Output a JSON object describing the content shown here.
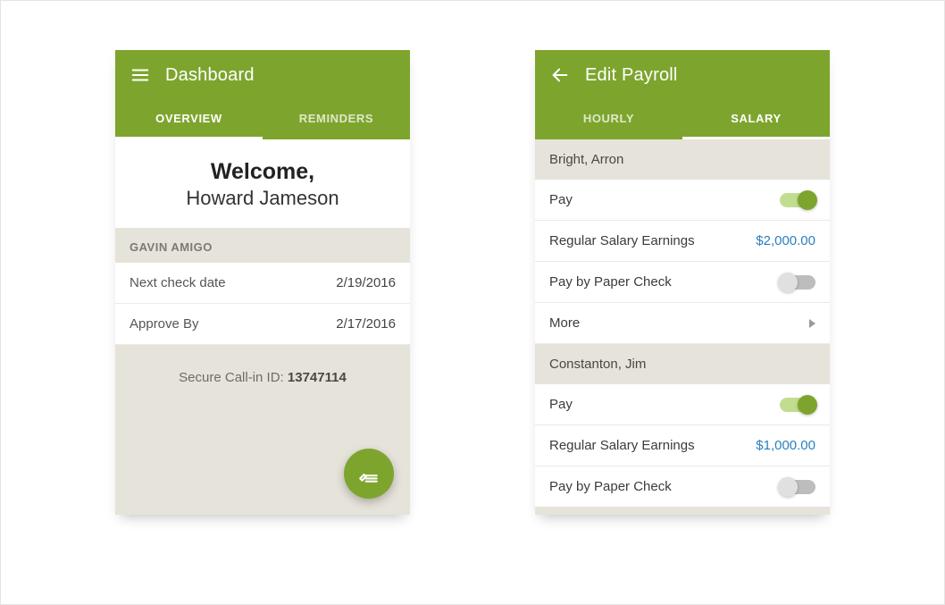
{
  "colors": {
    "accent": "#7da52e",
    "link": "#2a7fbf"
  },
  "left": {
    "title": "Dashboard",
    "tabs": {
      "overview": "OVERVIEW",
      "reminders": "REMINDERS",
      "active": "overview"
    },
    "welcome": {
      "heading": "Welcome,",
      "name": "Howard Jameson"
    },
    "section": {
      "label": "GAVIN AMIGO"
    },
    "rows": {
      "next_check": {
        "label": "Next check date",
        "value": "2/19/2016"
      },
      "approve_by": {
        "label": "Approve By",
        "value": "2/17/2016"
      }
    },
    "callin": {
      "prefix": "Secure Call-in ID: ",
      "value": "13747114"
    }
  },
  "right": {
    "title": "Edit Payroll",
    "tabs": {
      "hourly": "HOURLY",
      "salary": "SALARY",
      "active": "salary"
    },
    "labels": {
      "pay": "Pay",
      "regular_salary": "Regular Salary Earnings",
      "paper_check": "Pay by Paper Check",
      "more": "More"
    },
    "employees": [
      {
        "name": "Bright, Arron",
        "pay_on": true,
        "salary": "$2,000.00",
        "paper_check_on": false
      },
      {
        "name": "Constanton, Jim",
        "pay_on": true,
        "salary": "$1,000.00",
        "paper_check_on": false
      }
    ]
  }
}
